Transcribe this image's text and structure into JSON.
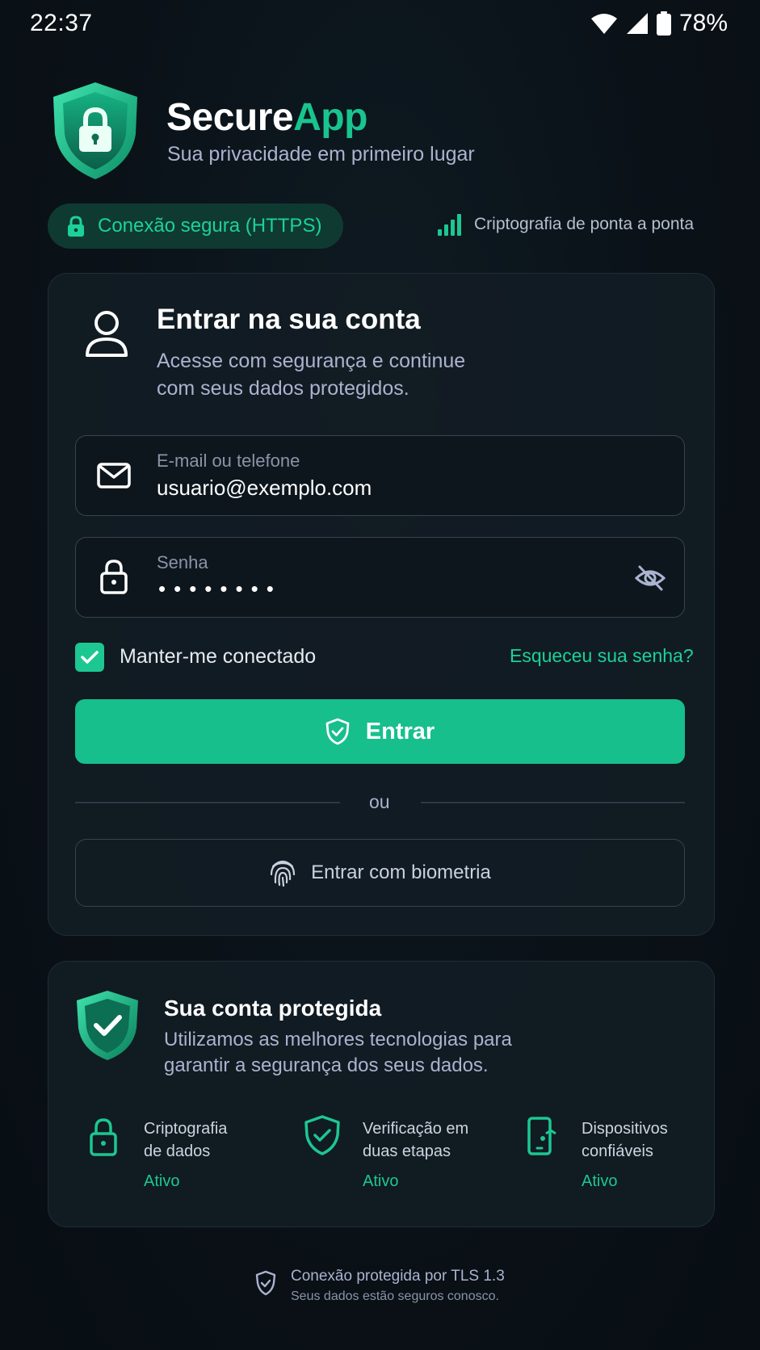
{
  "status_bar": {
    "time": "22:37",
    "battery": "78%"
  },
  "header": {
    "brand_main": "Secure",
    "brand_accent": "App",
    "tagline": "Sua privacidade em primeiro lugar"
  },
  "security": {
    "https_label": "Conexão segura (HTTPS)",
    "e2e_label": "Criptografia de ponta a ponta"
  },
  "login": {
    "title": "Entrar na sua conta",
    "subtitle": "Acesse com segurança e continue com seus dados protegidos.",
    "email_label": "E-mail ou telefone",
    "email_value": "usuario@exemplo.com",
    "password_label": "Senha",
    "password_value": "••••••••",
    "keep_connected": "Manter-me conectado",
    "keep_connected_checked": true,
    "forgot_password": "Esqueceu sua senha?",
    "submit": "Entrar",
    "or": "ou",
    "biometric": "Entrar com biometria"
  },
  "protection": {
    "title": "Sua conta protegida",
    "subtitle": "Utilizamos as melhores tecnologias para garantir a segurança dos seus dados.",
    "features": [
      {
        "label_line1": "Criptografia",
        "label_line2": "de dados",
        "status": "Ativo",
        "icon": "lock-icon"
      },
      {
        "label_line1": "Verificação em",
        "label_line2": "duas etapas",
        "status": "Ativo",
        "icon": "shield-check-icon"
      },
      {
        "label_line1": "Dispositivos",
        "label_line2": "confiáveis",
        "status": "Ativo",
        "icon": "device-icon"
      }
    ]
  },
  "footer": {
    "main": "Conexão protegida por TLS 1.3",
    "sub": "Seus dados estão seguros conosco."
  },
  "colors": {
    "accent": "#19c48e",
    "background": "#0a1117",
    "card": "#121c24"
  }
}
